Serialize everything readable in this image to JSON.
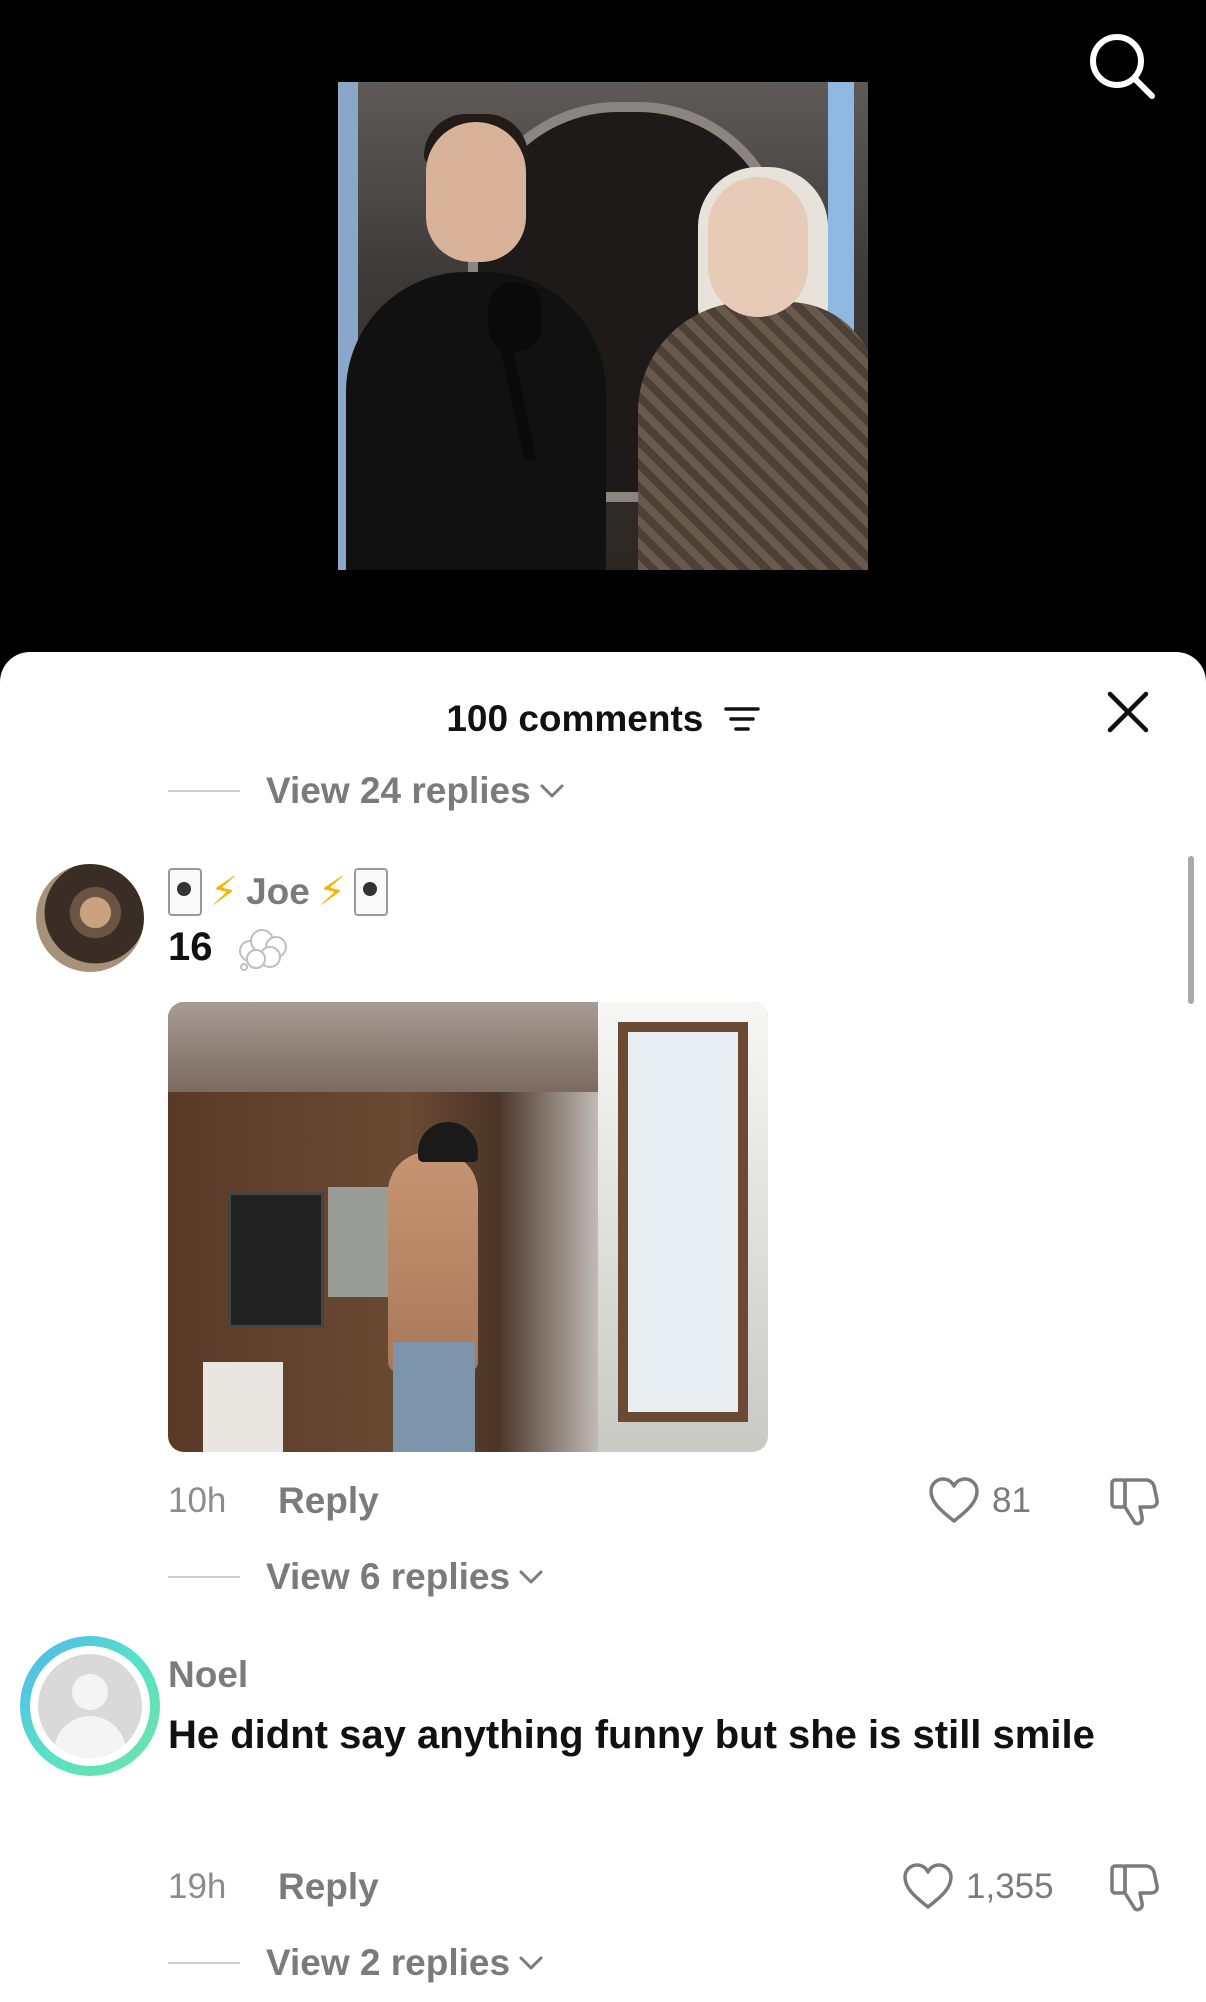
{
  "video": {
    "search_icon": "search-icon"
  },
  "comments_sheet": {
    "title": "100 comments",
    "sort_icon": "sort-icon",
    "close_icon": "close-icon",
    "top_thread": {
      "view_replies_label": "View 24 replies"
    },
    "comments": [
      {
        "username": "Joe",
        "username_decor": "🃏 ⚡ Joe ⚡ 🃏",
        "text": "16",
        "has_image": true,
        "time": "10h",
        "reply_label": "Reply",
        "likes": "81",
        "view_replies_label": "View 6 replies"
      },
      {
        "username": "Noel",
        "text": "He didnt say anything funny but she is still smile",
        "time": "19h",
        "reply_label": "Reply",
        "likes": "1,355",
        "view_replies_label": "View 2 replies"
      }
    ]
  }
}
